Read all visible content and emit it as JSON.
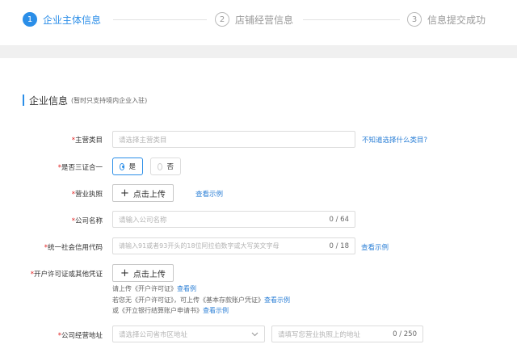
{
  "steps": [
    {
      "num": "1",
      "label": "企业主体信息"
    },
    {
      "num": "2",
      "label": "店铺经营信息"
    },
    {
      "num": "3",
      "label": "信息提交成功"
    }
  ],
  "section": {
    "title": "企业信息",
    "subtitle": "(暂时只支持境内企业入驻)"
  },
  "required_mark": "*",
  "form": {
    "category": {
      "label": "主营类目",
      "placeholder": "请选择主营类目",
      "help_link": "不知道选择什么类目?"
    },
    "three_in_one": {
      "label": "是否三证合一",
      "yes": "是",
      "no": "否"
    },
    "license": {
      "label": "营业执照",
      "upload": "点击上传",
      "example": "查看示例"
    },
    "company_name": {
      "label": "公司名称",
      "placeholder": "请输入公司名称",
      "count": "0 / 64"
    },
    "credit_code": {
      "label": "统一社会信用代码",
      "placeholder": "请输入91或者93开头的18位阿拉伯数字或大写英文字母",
      "count": "0 / 18",
      "example": "查看示例"
    },
    "account_permit": {
      "label": "开户许可证或其他凭证",
      "upload": "点击上传",
      "hint1": "请上传《开户许可证》",
      "hint1_link": "查看例",
      "hint2": "若您无《开户许可证》，可上传《基本存款账户凭证》",
      "hint2_link": "查看示例",
      "hint3": "或《开立银行结算账户申请书》",
      "hint3_link": "查看示例"
    },
    "address": {
      "label": "公司经营地址",
      "region_placeholder": "请选择公司省市区地址",
      "detail_placeholder": "请填写您营业执照上的地址",
      "count": "0 / 250"
    }
  },
  "colors": {
    "accent": "#2b8ee8",
    "link": "#2b7fd6",
    "required": "#e02020"
  }
}
